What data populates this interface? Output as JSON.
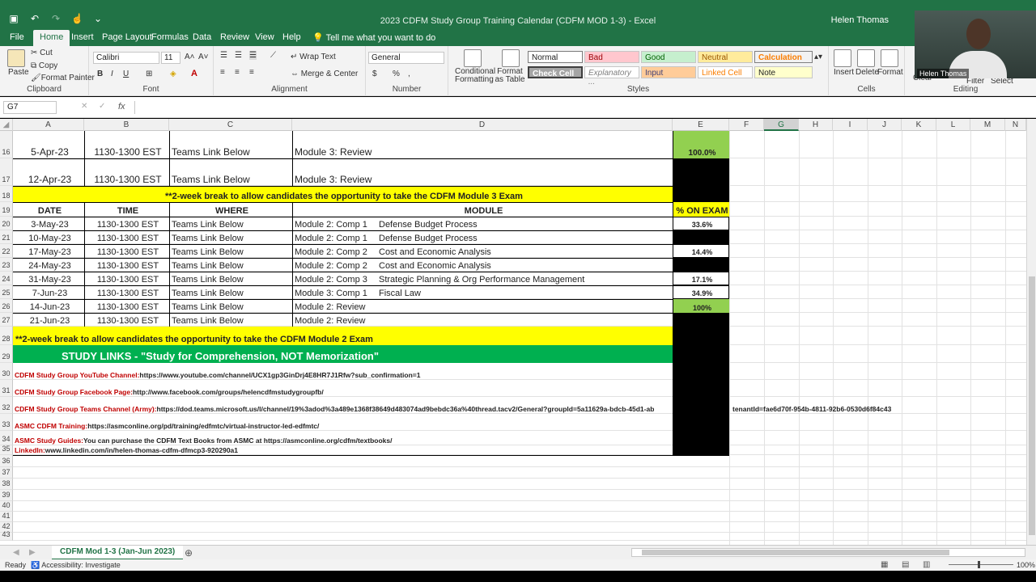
{
  "titlebar": {
    "doc_title": "2023 CDFM Study Group Training Calendar  (CDFM MOD 1-3)  -  Excel",
    "user": "Helen Thomas"
  },
  "tabs": [
    {
      "label": "File"
    },
    {
      "label": "Home"
    },
    {
      "label": "Insert"
    },
    {
      "label": "Page Layout"
    },
    {
      "label": "Formulas"
    },
    {
      "label": "Data"
    },
    {
      "label": "Review"
    },
    {
      "label": "View"
    },
    {
      "label": "Help"
    },
    {
      "label": "Tell me what you want to do"
    }
  ],
  "ribbon": {
    "clipboard": {
      "paste": "Paste",
      "cut": "Cut",
      "copy": "Copy",
      "format_painter": "Format Painter",
      "label": "Clipboard"
    },
    "font": {
      "name": "Calibri",
      "size": "11",
      "bold": "B",
      "italic": "I",
      "underline": "U",
      "label": "Font"
    },
    "alignment": {
      "wrap": "Wrap Text",
      "merge": "Merge & Center",
      "label": "Alignment"
    },
    "number": {
      "format": "General",
      "currency": "$",
      "percent": "%",
      "comma": ",",
      "label": "Number"
    },
    "styles": {
      "conditional": "Conditional Formatting",
      "format_table": "Format as Table",
      "normal": "Normal",
      "bad": "Bad",
      "good": "Good",
      "neutral": "Neutral",
      "calculation": "Calculation",
      "check_cell": "Check Cell",
      "explanatory": "Explanatory ...",
      "input": "Input",
      "linked_cell": "Linked Cell",
      "note": "Note",
      "label": "Styles"
    },
    "cells": {
      "insert": "Insert",
      "delete": "Delete",
      "format": "Format",
      "label": "Cells"
    },
    "editing": {
      "clear": "Clear",
      "filter": "Filter",
      "select": "Select",
      "label": "Editing"
    }
  },
  "formula_bar": {
    "name_box": "G7",
    "fx": "fx",
    "value": ""
  },
  "columns": [
    "A",
    "B",
    "C",
    "D",
    "E",
    "F",
    "G",
    "H",
    "I",
    "J",
    "K",
    "L",
    "M",
    "N"
  ],
  "selected_column": "G",
  "rows": {
    "r16": {
      "num": "16",
      "date": "5-Apr-23",
      "time": "1130-1300 EST",
      "where": "Teams Link Below",
      "module": "Module 3: Review",
      "pct": "100.0%"
    },
    "r17": {
      "num": "17",
      "date": "12-Apr-23",
      "time": "1130-1300 EST",
      "where": "Teams Link Below",
      "module": "Module 3: Review",
      "pct": ""
    },
    "r18": {
      "num": "18",
      "text": "**2-week break to allow candidates the opportunity to take the CDFM Module 3 Exam"
    },
    "r19": {
      "num": "19",
      "date": "DATE",
      "time": "TIME",
      "where": "WHERE",
      "module": "MODULE",
      "pct": "% ON EXAM"
    },
    "data": [
      {
        "num": "20",
        "date": "3-May-23",
        "time": "1130-1300 EST",
        "where": "Teams Link Below",
        "module": "Module 2: Comp 1",
        "topic": "Defense Budget Process",
        "pct": "33.6%",
        "pct_style": "white"
      },
      {
        "num": "21",
        "date": "10-May-23",
        "time": "1130-1300 EST",
        "where": "Teams Link Below",
        "module": "Module 2: Comp 1",
        "topic": "Defense Budget Process",
        "pct": "",
        "pct_style": "black"
      },
      {
        "num": "22",
        "date": "17-May-23",
        "time": "1130-1300 EST",
        "where": "Teams Link Below",
        "module": "Module 2: Comp 2",
        "topic": "Cost and Economic Analysis",
        "pct": "14.4%",
        "pct_style": "white"
      },
      {
        "num": "23",
        "date": "24-May-23",
        "time": "1130-1300 EST",
        "where": "Teams Link Below",
        "module": "Module 2: Comp 2",
        "topic": "Cost and Economic Analysis",
        "pct": "",
        "pct_style": "black"
      },
      {
        "num": "24",
        "date": "31-May-23",
        "time": "1130-1300 EST",
        "where": "Teams Link Below",
        "module": "Module 2: Comp 3",
        "topic": "Strategic Planning & Org Performance Management",
        "pct": "17.1%",
        "pct_style": "white"
      },
      {
        "num": "25",
        "date": "7-Jun-23",
        "time": "1130-1300 EST",
        "where": "Teams Link Below",
        "module": "Module 3: Comp 1",
        "topic": "Fiscal Law",
        "pct": "34.9%",
        "pct_style": "white"
      },
      {
        "num": "26",
        "date": "14-Jun-23",
        "time": "1130-1300 EST",
        "where": "Teams Link Below",
        "module": "Module 2: Review",
        "topic": "",
        "pct": "100%",
        "pct_style": "green"
      },
      {
        "num": "27",
        "date": "21-Jun-23",
        "time": "1130-1300 EST",
        "where": "Teams Link Below",
        "module": "Module 2: Review",
        "topic": "",
        "pct": "",
        "pct_style": "black"
      }
    ],
    "r28": {
      "num": "28",
      "text": "**2-week break to allow candidates the opportunity to take the CDFM Module 2 Exam"
    },
    "r29": {
      "num": "29",
      "text": "STUDY LINKS - \"Study for Comprehension, NOT Memorization\""
    },
    "links": [
      {
        "num": "30",
        "label": "CDFM Study Group YouTube Channel:",
        "value": " https://www.youtube.com/channel/UCX1gp3GinDrj4E8HR7J1Rfw?sub_confirmation=1"
      },
      {
        "num": "31",
        "label": "CDFM Study Group Facebook Page:",
        "value": " http://www.facebook.com/groups/helencdfmstudygroupfb/"
      },
      {
        "num": "32",
        "label": "CDFM Study Group Teams Channel (Army):",
        "value": " https://dod.teams.microsoft.us/l/channel/19%3adod%3a489e1368f38649d483074ad9bebdc36a%40thread.tacv2/General?groupId=5a11629a-bdcb-45d1-ab",
        "tail": "tenantId=fae6d70f-954b-4811-92b6-0530d6f84c43"
      },
      {
        "num": "33",
        "label": "ASMC CDFM Training:",
        "value": "   https://asmconline.org/pd/training/edfmtc/virtual-instructor-led-edfmtc/"
      },
      {
        "num": "34",
        "label": "ASMC Study Guides:",
        "value": " You can purchase the CDFM Text Books from ASMC at https://asmconline.org/cdfm/textbooks/"
      },
      {
        "num": "35",
        "label": "LinkedIn:",
        "value": " www.linkedin.com/in/helen-thomas-cdfm-dfmcp3-920290a1"
      }
    ],
    "empty": [
      "36",
      "37",
      "38",
      "39",
      "40",
      "41",
      "42",
      "43"
    ]
  },
  "sheet_tab": "CDFM Mod 1-3 (Jan-Jun 2023)",
  "status": {
    "ready": "Ready",
    "accessibility": "Accessibility: Investigate",
    "zoom": "100%"
  },
  "webcam": {
    "name": "Helen Thomas"
  },
  "colors": {
    "excel_green": "#217346",
    "yellow": "#ffff00",
    "green_band": "#00b050",
    "link_red": "#c00000",
    "pct_green": "#92d050"
  }
}
